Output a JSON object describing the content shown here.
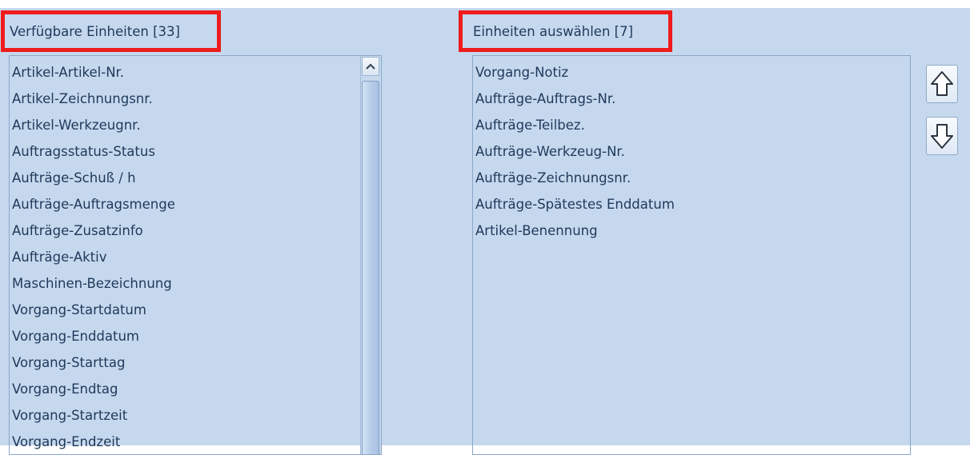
{
  "available": {
    "title": "Verfügbare Einheiten [33]",
    "items": [
      "Artikel-Artikel-Nr.",
      "Artikel-Zeichnungsnr.",
      "Artikel-Werkzeugnr.",
      "Auftragsstatus-Status",
      "Aufträge-Schuß / h",
      "Aufträge-Auftragsmenge",
      "Aufträge-Zusatzinfo",
      "Aufträge-Aktiv",
      "Maschinen-Bezeichnung",
      "Vorgang-Startdatum",
      "Vorgang-Enddatum",
      "Vorgang-Starttag",
      "Vorgang-Endtag",
      "Vorgang-Startzeit",
      "Vorgang-Endzeit"
    ]
  },
  "selected": {
    "title": "Einheiten auswählen [7]",
    "items": [
      "Vorgang-Notiz",
      "Aufträge-Auftrags-Nr.",
      "Aufträge-Teilbez.",
      "Aufträge-Werkzeug-Nr.",
      "Aufträge-Zeichnungsnr.",
      "Aufträge-Spätestes Enddatum",
      "Artikel-Benennung"
    ]
  },
  "icons": {
    "move_up": "arrow-up-icon",
    "move_down": "arrow-down-icon",
    "scroll_up": "chevron-up-icon"
  },
  "colors": {
    "panel_background": "#c6d8ed",
    "text": "#1e395b",
    "highlight": "#ee1c1c"
  }
}
